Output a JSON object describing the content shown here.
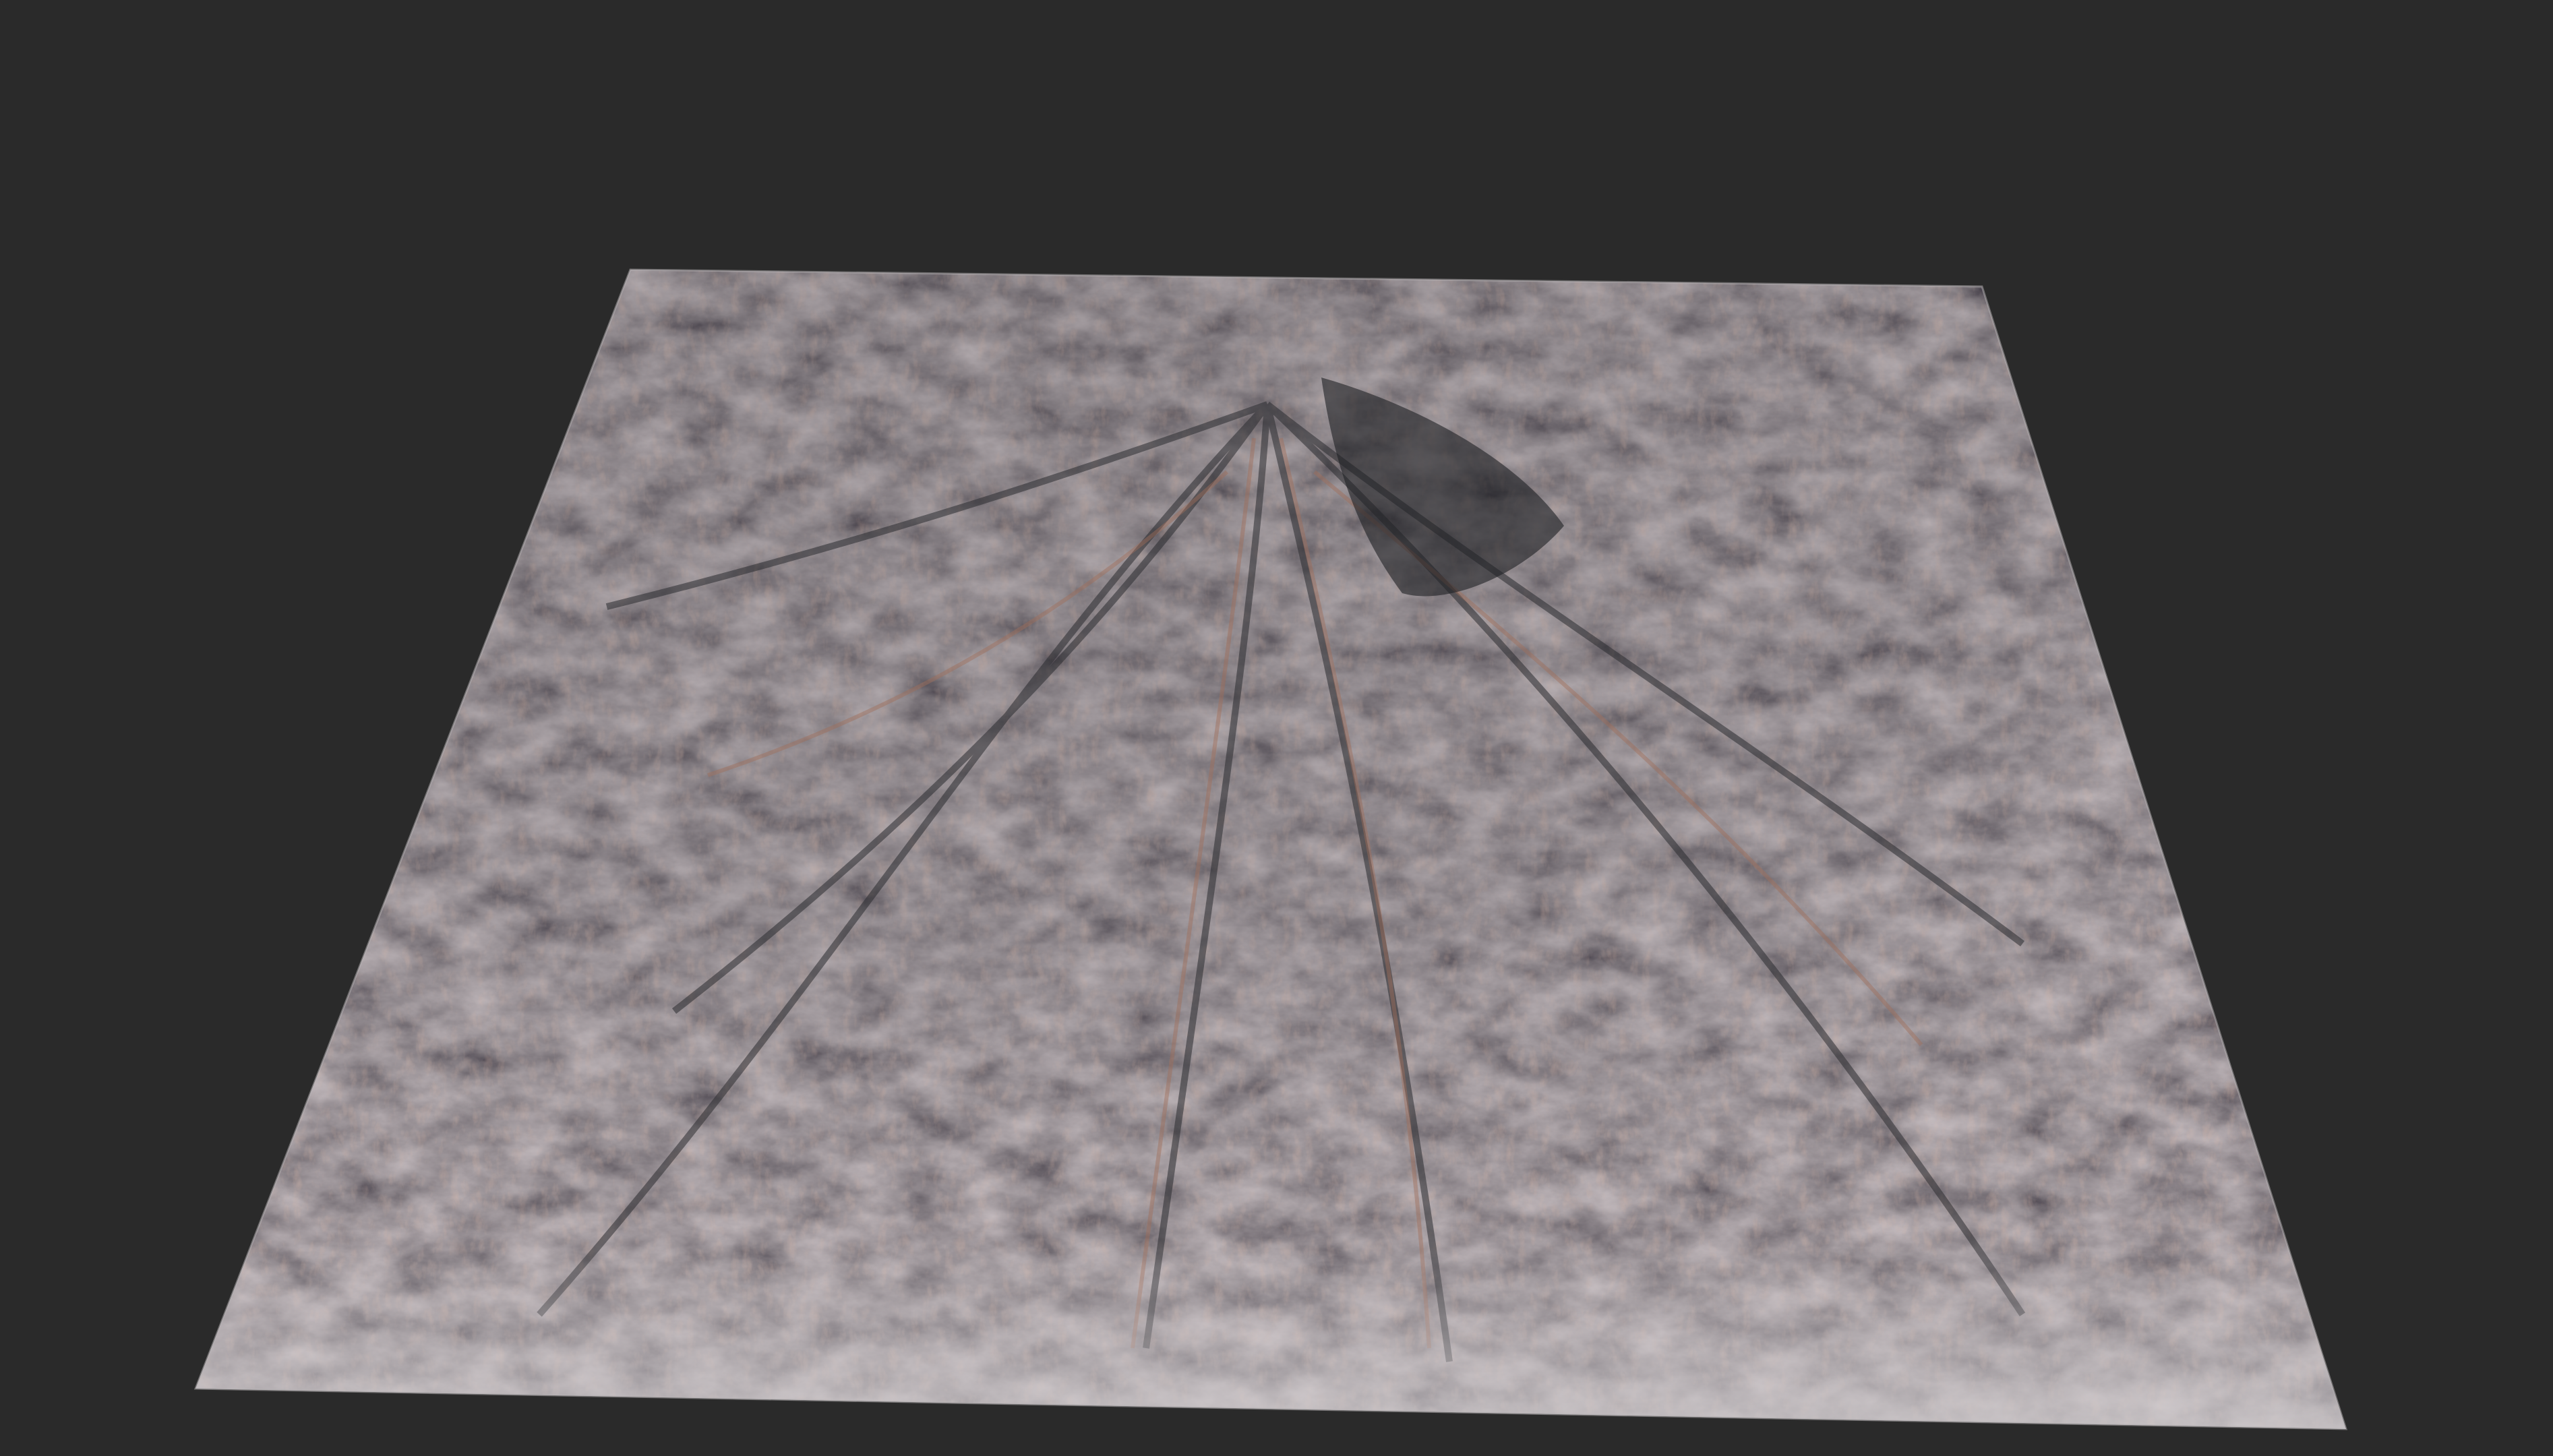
{
  "scene": {
    "background_color": "#2a2a2a",
    "object": "terrain-heightmap",
    "palette": {
      "rock_dark": "#34353a",
      "rock_mid": "#5a5a5f",
      "rock_light": "#8c8a8b",
      "rust": "#a06e5a",
      "sand": "#c9c4c6",
      "shadow": "#1e1f23"
    }
  }
}
